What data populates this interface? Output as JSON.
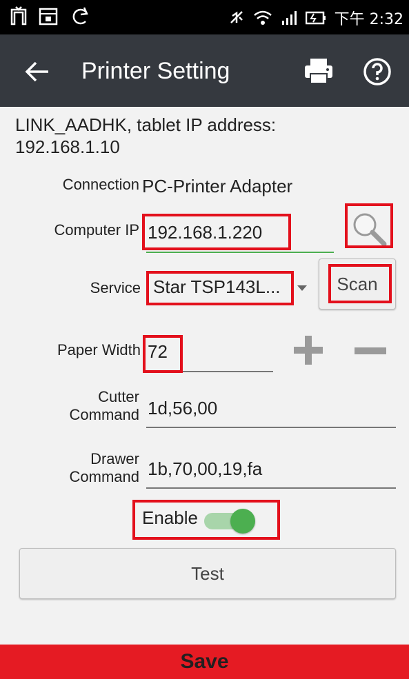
{
  "status_bar": {
    "time": "下午 2:32"
  },
  "app_bar": {
    "title": "Printer Setting"
  },
  "info_text_line1": "LINK_AADHK, tablet IP address:",
  "info_text_line2": "192.168.1.10",
  "connection": {
    "label": "Connection",
    "value": "PC-Printer Adapter"
  },
  "computer_ip": {
    "label": "Computer IP",
    "value": "192.168.1.220"
  },
  "service": {
    "label": "Service",
    "value": "Star TSP143L...",
    "scan_label": "Scan"
  },
  "paper_width": {
    "label": "Paper Width",
    "value": "72"
  },
  "cutter": {
    "label_line1": "Cutter",
    "label_line2": "Command",
    "value": "1d,56,00"
  },
  "drawer": {
    "label_line1": "Drawer",
    "label_line2": "Command",
    "value": "1b,70,00,19,fa"
  },
  "enable": {
    "label": "Enable",
    "on": true
  },
  "test_button": "Test",
  "save_button": "Save",
  "colors": {
    "appbar": "#35393f",
    "accent_green": "#4caf50",
    "save_red": "#e51b23",
    "highlight_red": "#e3101c"
  }
}
